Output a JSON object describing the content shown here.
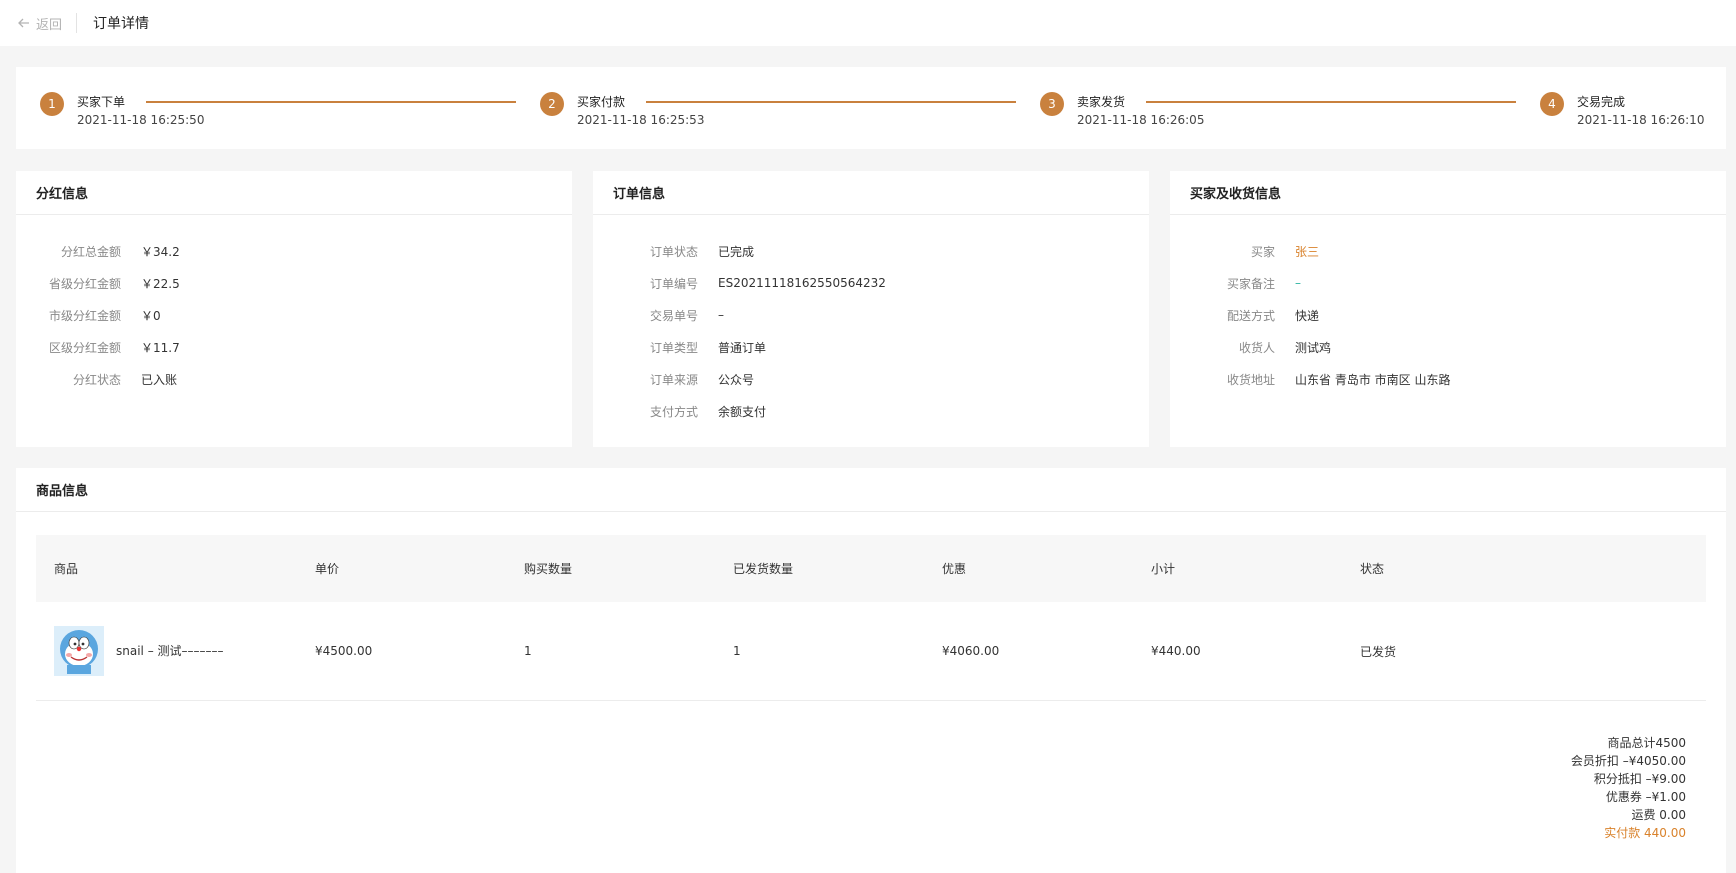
{
  "header": {
    "back_label": "返回",
    "title": "订单详情"
  },
  "steps": [
    {
      "num": "1",
      "label": "买家下单",
      "time": "2021-11-18 16:25:50"
    },
    {
      "num": "2",
      "label": "买家付款",
      "time": "2021-11-18 16:25:53"
    },
    {
      "num": "3",
      "label": "卖家发货",
      "time": "2021-11-18 16:26:05"
    },
    {
      "num": "4",
      "label": "交易完成",
      "time": "2021-11-18 16:26:10"
    }
  ],
  "dividend": {
    "title": "分红信息",
    "rows": [
      {
        "k": "分红总金额",
        "v": "￥34.2"
      },
      {
        "k": "省级分红金额",
        "v": "￥22.5"
      },
      {
        "k": "市级分红金额",
        "v": "￥0"
      },
      {
        "k": "区级分红金额",
        "v": "￥11.7"
      },
      {
        "k": "分红状态",
        "v": "已入账"
      }
    ]
  },
  "order": {
    "title": "订单信息",
    "rows": [
      {
        "k": "订单状态",
        "v": "已完成"
      },
      {
        "k": "订单编号",
        "v": "ES20211118162550564232"
      },
      {
        "k": "交易单号",
        "v": "–"
      },
      {
        "k": "订单类型",
        "v": "普通订单"
      },
      {
        "k": "订单来源",
        "v": "公众号"
      },
      {
        "k": "支付方式",
        "v": "余额支付"
      }
    ]
  },
  "buyer": {
    "title": "买家及收货信息",
    "rows": [
      {
        "k": "买家",
        "v": "张三"
      },
      {
        "k": "买家备注",
        "v": "–"
      },
      {
        "k": "配送方式",
        "v": "快递"
      },
      {
        "k": "收货人",
        "v": "测试鸡"
      },
      {
        "k": "收货地址",
        "v": "山东省 青岛市 市南区 山东路"
      }
    ]
  },
  "goods": {
    "title": "商品信息",
    "columns": [
      "商品",
      "单价",
      "购买数量",
      "已发货数量",
      "优惠",
      "小计",
      "状态"
    ],
    "rows": [
      {
        "name": "snail – 测试–––––––",
        "price": "¥4500.00",
        "qty": "1",
        "shipped": "1",
        "discount": "¥4060.00",
        "subtotal": "¥440.00",
        "status": "已发货"
      }
    ],
    "summary": {
      "total": "商品总计4500",
      "member": "会员折扣 –¥4050.00",
      "points": "积分抵扣 –¥9.00",
      "coupon": "优惠券 –¥1.00",
      "shipping": "运费 0.00",
      "paid": "实付款 440.00"
    }
  },
  "colors": {
    "accent": "#c9813e",
    "paid": "#d9822b",
    "remark": "#2bb3a0"
  }
}
